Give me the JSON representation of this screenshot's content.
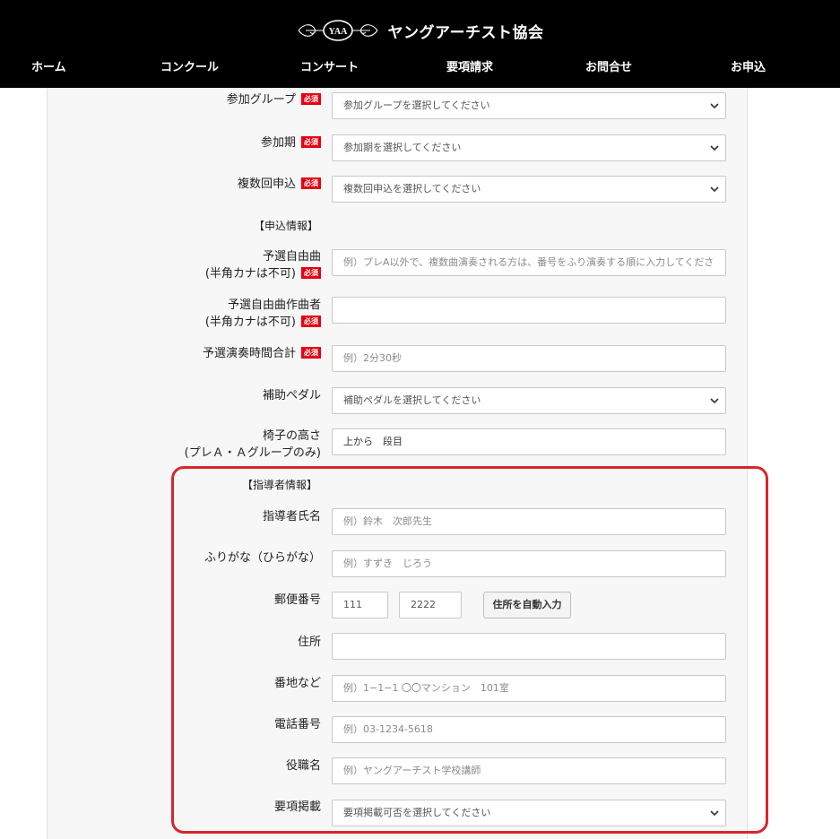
{
  "header": {
    "logo_emblem": "YAA",
    "site_title": "ヤングアーチスト協会",
    "nav": [
      "ホーム",
      "コンクール",
      "コンサート",
      "要項請求",
      "お問合せ",
      "お申込"
    ]
  },
  "required_badge": "必須",
  "form": {
    "group": {
      "label": "参加グループ",
      "select_value": "参加グループを選択してください"
    },
    "period": {
      "label": "参加期",
      "select_value": "参加期を選択してください"
    },
    "multi": {
      "label": "複数回申込",
      "select_value": "複数回申込を選択してください"
    },
    "application_section": "【申込情報】",
    "piece": {
      "label_line1": "予選自由曲",
      "label_line2": "(半角カナは不可)",
      "placeholder": "例）プレA以外で、複数曲演奏される方は、番号をふり演奏する順に入力してくださ"
    },
    "composer": {
      "label_line1": "予選自由曲作曲者",
      "label_line2": "(半角カナは不可)",
      "value": ""
    },
    "duration": {
      "label": "予選演奏時間合計",
      "placeholder": "例）2分30秒"
    },
    "pedal": {
      "label": "補助ペダル",
      "select_value": "補助ペダルを選択してください"
    },
    "chair": {
      "label_line1": "椅子の高さ",
      "label_line2": "(プレＡ・Ａグループのみ)",
      "value": "上から　段目"
    },
    "teacher_section": "【指導者情報】",
    "teacher_name": {
      "label": "指導者氏名",
      "placeholder": "例）鈴木　次郎先生"
    },
    "furigana": {
      "label": "ふりがな（ひらがな）",
      "placeholder": "例）すずき　じろう"
    },
    "postal": {
      "label": "郵便番号",
      "part1": "111",
      "part2": "2222",
      "button": "住所を自動入力"
    },
    "address": {
      "label": "住所",
      "value": ""
    },
    "street": {
      "label": "番地など",
      "placeholder": "例）1−1−1 〇〇マンション　101室"
    },
    "phone": {
      "label": "電話番号",
      "placeholder": "例）03-1234-5618"
    },
    "title": {
      "label": "役職名",
      "placeholder": "例）ヤングアーチスト学校講師"
    },
    "publish": {
      "label": "要項掲載",
      "select_value": "要項掲載可否を選択してください"
    }
  },
  "colors": {
    "header_bg": "#000000",
    "required_badge": "#e60012",
    "highlight_border": "#d6262c",
    "panel_bg": "#f7f7f7"
  }
}
